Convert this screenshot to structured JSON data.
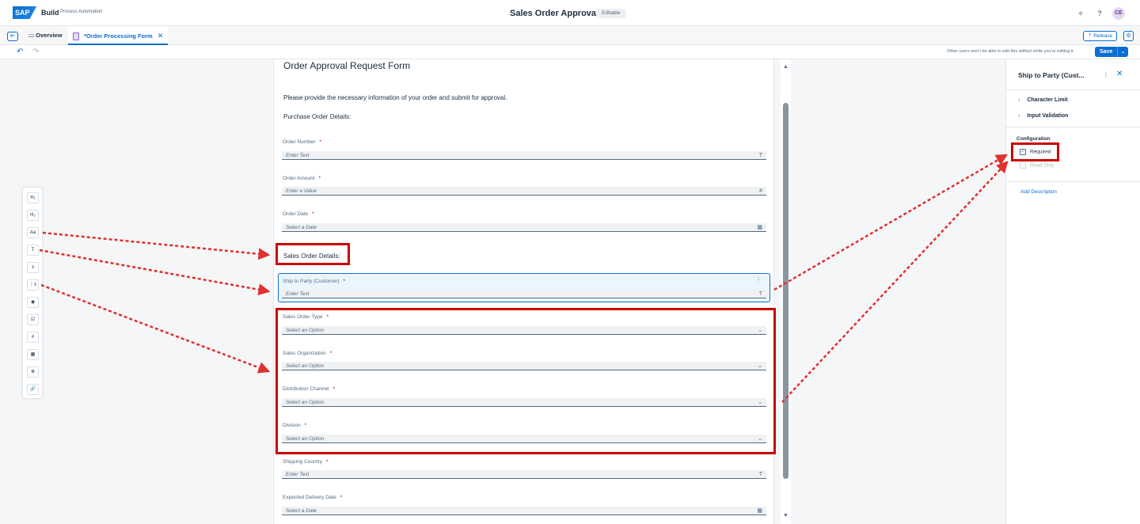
{
  "shell": {
    "logo": "SAP",
    "brand": "Build",
    "brand_sub": "Process Automation",
    "title": "Sales Order Approval",
    "badge": "Editable",
    "avatar": "CE"
  },
  "tabs": {
    "overview": "Overview",
    "form": "*Order Processing Form",
    "release": "Release"
  },
  "toolbar": {
    "note": "Other users won't be able to edit this artifact while you're editing it.",
    "save": "Save"
  },
  "palette": [
    "H₁",
    "H₂",
    "Aa",
    "T",
    "≡",
    "⋮≡",
    "◉",
    "☑",
    "#",
    "▦",
    "≣",
    "🔗"
  ],
  "form": {
    "title": "Order Approval Request Form",
    "intro": "Please provide the necessary information of your order and submit for approval.",
    "section1": "Purchase Order Details:",
    "section2": "Sales Order Details:",
    "fields": [
      {
        "label": "Order Number",
        "placeholder": "Enter Text",
        "icon": "T"
      },
      {
        "label": "Order Amount",
        "placeholder": "Enter a Value",
        "icon": "#"
      },
      {
        "label": "Order Date",
        "placeholder": "Select a Date",
        "icon": "▦"
      },
      {
        "label": "Ship to Party (Customer)",
        "placeholder": "Enter Text",
        "icon": "T"
      },
      {
        "label": "Sales Order Type",
        "placeholder": "Select an Option",
        "icon": "⌄"
      },
      {
        "label": "Sales Organization",
        "placeholder": "Select an Option",
        "icon": "⌄"
      },
      {
        "label": "Distribution Channel",
        "placeholder": "Select an Option",
        "icon": "⌄"
      },
      {
        "label": "Division",
        "placeholder": "Select an Option",
        "icon": "⌄"
      },
      {
        "label": "Shipping Country",
        "placeholder": "Enter Text",
        "icon": "T"
      },
      {
        "label": "Expected Delivery Date",
        "placeholder": "Select a Date",
        "icon": "▦"
      }
    ],
    "required_marker": "*"
  },
  "panel": {
    "title": "Ship to Party (Cust...",
    "expanders": [
      "Character Limit",
      "Input Validation"
    ],
    "section": "Configuration",
    "required": "Required",
    "read_only": "Read Only",
    "add_description": "Add Description"
  },
  "colors": {
    "accent": "#0a6ed1",
    "annotation": "#cc0000",
    "required": "#bb0000"
  }
}
